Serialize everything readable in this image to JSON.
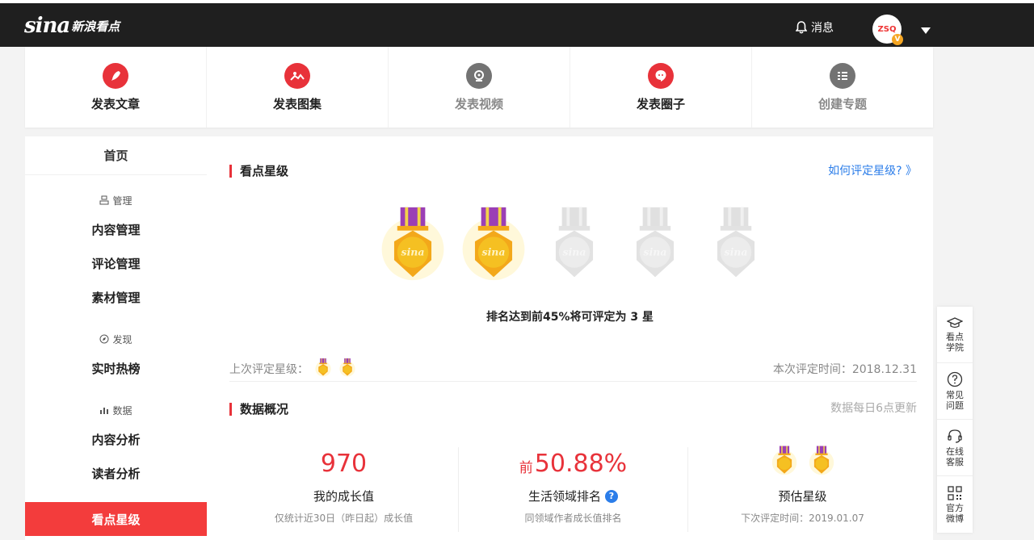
{
  "header": {
    "logo_mark": "sina",
    "logo_text": "新浪看点",
    "messages_label": "消息",
    "avatar_text": "ZSQ",
    "avatar_badge": "V"
  },
  "actions": [
    {
      "label": "发表文章",
      "icon": "pen-icon",
      "enabled": true
    },
    {
      "label": "发表图集",
      "icon": "image-icon",
      "enabled": true
    },
    {
      "label": "发表视频",
      "icon": "video-icon",
      "enabled": false
    },
    {
      "label": "发表圈子",
      "icon": "circle-chat-icon",
      "enabled": true
    },
    {
      "label": "创建专题",
      "icon": "list-icon",
      "enabled": false
    }
  ],
  "sidebar": {
    "home": "首页",
    "group_manage": "管理",
    "content_manage": "内容管理",
    "comment_manage": "评论管理",
    "material_manage": "素材管理",
    "group_discover": "发现",
    "hot_list": "实时热榜",
    "group_data": "数据",
    "content_analysis": "内容分析",
    "reader_analysis": "读者分析",
    "star_rating": "看点星级"
  },
  "star_section": {
    "title": "看点星级",
    "help_link": "如何评定星级? 》",
    "earned_medals": 2,
    "total_medals": 5,
    "medal_text": "sina",
    "rank_note": "排名达到前45%将可评定为 3 星",
    "last_rating_label": "上次评定星级：",
    "last_rating_medals": 2,
    "rating_time": "本次评定时间：2018.12.31"
  },
  "data_section": {
    "title": "数据概况",
    "update_note": "数据每日6点更新",
    "growth_value": "970",
    "growth_label": "我的成长值",
    "growth_sub": "仅统计近30日（昨日起）成长值",
    "rank_prefix": "前",
    "rank_value": "50.88%",
    "rank_label": "生活领域排名",
    "rank_sub": "同领域作者成长值排名",
    "est_label": "预估星级",
    "est_sub": "下次评定时间：2019.01.07",
    "est_medals": 2
  },
  "float_bar": [
    {
      "label": "看点学院",
      "icon": "graduation-cap-icon"
    },
    {
      "label": "常见问题",
      "icon": "question-icon"
    },
    {
      "label": "在线客服",
      "icon": "headset-icon"
    },
    {
      "label": "官方微博",
      "icon": "qr-code-icon"
    }
  ],
  "colors": {
    "accent": "#e8323a",
    "link": "#2b7de9",
    "header_bg": "#1f1f1f",
    "medal_gold": "#f5c022",
    "medal_ribbon": "#9b3fb5"
  }
}
